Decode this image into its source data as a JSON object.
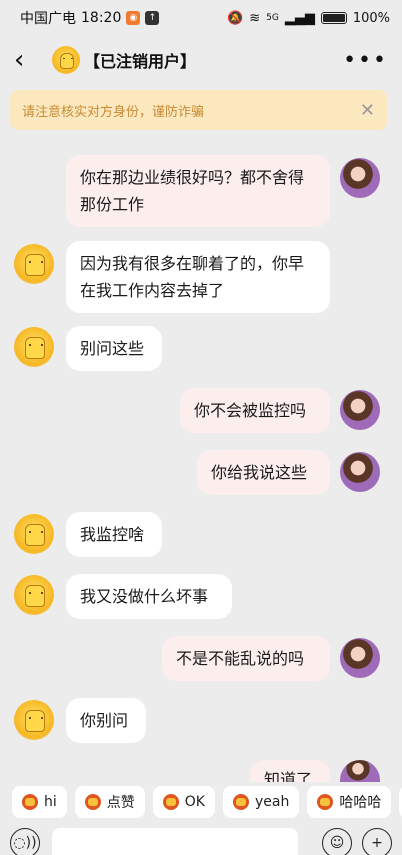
{
  "status_bar": {
    "carrier": "中国广电",
    "time": "18:20",
    "network": "5G",
    "battery": "100%"
  },
  "nav": {
    "back_icon": "‹",
    "title": "【已注销用户】",
    "more_icon": "•••"
  },
  "warning": {
    "text": "请注意核实对方身份，谨防诈骗",
    "close_icon": "✕"
  },
  "messages": [
    {
      "side": "sent",
      "text": "你在那边业绩很好吗？都不舍得那份工作"
    },
    {
      "side": "recv",
      "text": "因为我有很多在聊着了的，你早在我工作内容去掉了"
    },
    {
      "side": "recv",
      "text": "别问这些"
    },
    {
      "side": "sent",
      "text": "你不会被监控吗"
    },
    {
      "side": "sent",
      "text": "你给我说这些"
    },
    {
      "side": "recv",
      "text": "我监控啥"
    },
    {
      "side": "recv",
      "text": "我又没做什么坏事"
    },
    {
      "side": "sent",
      "text": "不是不能乱说的吗"
    },
    {
      "side": "recv",
      "text": "你别问"
    },
    {
      "side": "sent",
      "text": "知道了"
    }
  ],
  "quick_replies": [
    "hi",
    "点赞",
    "OK",
    "yeah",
    "哈哈哈"
  ],
  "input": {
    "voice_icon": "voice-icon",
    "emoji_icon": "emoji-icon",
    "plus_icon": "plus-icon"
  }
}
